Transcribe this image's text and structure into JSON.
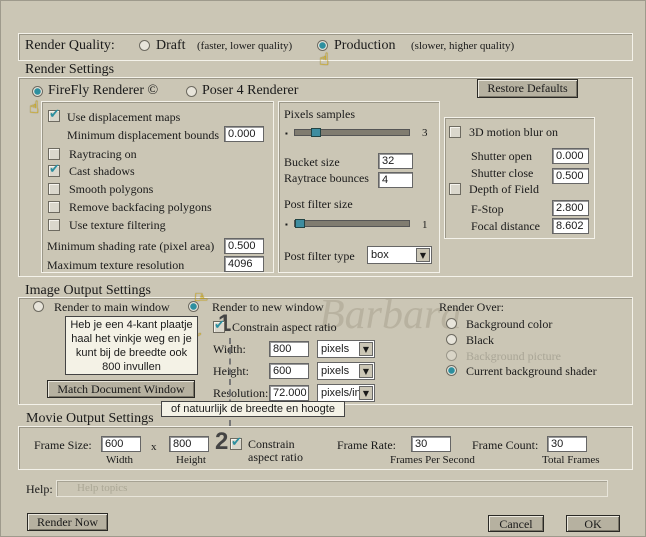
{
  "render_quality": {
    "label": "Render Quality:",
    "draft_label": "Draft",
    "draft_note": "(faster, lower quality)",
    "production_label": "Production",
    "production_note": "(slower, higher quality)",
    "selected": "production"
  },
  "render_settings": {
    "title": "Render Settings",
    "firefly_label": "FireFly Renderer ©",
    "poser4_label": "Poser 4 Renderer",
    "restore_defaults": "Restore Defaults",
    "use_displacement_maps": "Use displacement maps",
    "min_displacement_bounds_label": "Minimum displacement bounds",
    "min_displacement_bounds": "0.000",
    "raytracing_on": "Raytracing on",
    "cast_shadows": "Cast shadows",
    "smooth_polygons": "Smooth polygons",
    "remove_backfacing": "Remove backfacing polygons",
    "use_texture_filtering": "Use texture filtering",
    "min_shading_rate_label": "Minimum shading rate (pixel area)",
    "min_shading_rate": "0.500",
    "max_texture_res_label": "Maximum texture resolution",
    "max_texture_res": "4096",
    "pixel_samples_label": "Pixels samples",
    "pixel_samples_value": "3",
    "pixel_samples_level": 0.15,
    "bucket_size_label": "Bucket size",
    "bucket_size": "32",
    "raytrace_bounces_label": "Raytrace bounces",
    "raytrace_bounces": "4",
    "post_filter_size_label": "Post filter size",
    "post_filter_size_value": "1",
    "post_filter_size_level": 0.0,
    "post_filter_type_label": "Post filter type",
    "post_filter_type": "box",
    "motion_blur_label": "3D motion blur on",
    "shutter_open_label": "Shutter open",
    "shutter_open": "0.000",
    "shutter_close_label": "Shutter close",
    "shutter_close": "0.500",
    "depth_of_field_label": "Depth of Field",
    "fstop_label": "F-Stop",
    "fstop": "2.800",
    "focal_distance_label": "Focal distance",
    "focal_distance": "8.602"
  },
  "image_output": {
    "title": "Image Output Settings",
    "render_main_window": "Render to main window",
    "render_new_window": "Render to new window",
    "constrain_aspect": "Constrain aspect ratio",
    "width_label": "Width:",
    "width": "800",
    "height_label": "Height:",
    "height": "600",
    "resolution_label": "Resolution:",
    "resolution": "72.000",
    "unit_pixels": "pixels",
    "unit_pixels_in": "pixels/in",
    "match_document": "Match Document Window",
    "render_over_label": "Render Over:",
    "background_color": "Background color",
    "black": "Black",
    "background_picture": "Background picture",
    "current_background_shader": "Current background shader"
  },
  "annotations": {
    "note1": "Heb je een 4-kant plaatje haal het vinkje weg en je kunt bij de breedte ook 800 invullen",
    "note2": "of natuurlijk de breedte en hoogte",
    "num1": "1",
    "num2": "2",
    "watermark": "Barbara"
  },
  "movie_output": {
    "title": "Movie Output Settings",
    "frame_size_label": "Frame Size:",
    "frame_width": "600",
    "times": "x",
    "frame_height": "800",
    "width_caption": "Width",
    "height_caption": "Height",
    "constrain_label_1": "Constrain",
    "constrain_label_2": "aspect ratio",
    "frame_rate_label": "Frame Rate:",
    "frame_rate": "30",
    "frames_per_second": "Frames Per Second",
    "frame_count_label": "Frame Count:",
    "frame_count": "30",
    "total_frames": "Total Frames"
  },
  "help": {
    "label": "Help:",
    "placeholder": "Help topics"
  },
  "footer": {
    "render_now": "Render Now",
    "cancel": "Cancel",
    "ok": "OK"
  },
  "colors": {
    "dialog_bg": "#cbc6b5",
    "accent": "#2d8f9f"
  }
}
